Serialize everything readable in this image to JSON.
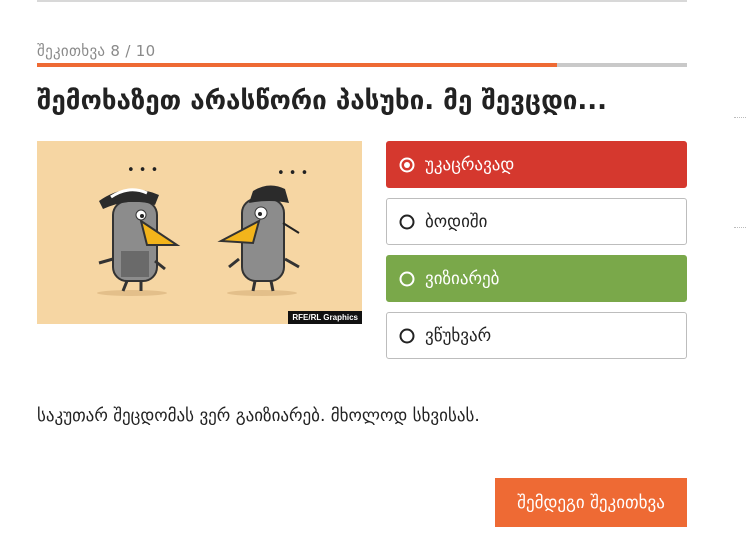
{
  "quiz": {
    "counter": "შეკითხვა 8 / 10",
    "progress_fraction": 0.8,
    "question": "შემოხაზეთ არასწორი პასუხი. მე შევცდი...",
    "image": {
      "credit": "RFE/RL Graphics",
      "thought_dots_left": "• • •",
      "thought_dots_right": "• • •"
    },
    "options": [
      {
        "label": "უკაცრავად",
        "state": "selected-wrong"
      },
      {
        "label": "ბოდიში",
        "state": "none"
      },
      {
        "label": "ვიზიარებ",
        "state": "correct"
      },
      {
        "label": "ვწუხვარ",
        "state": "none"
      }
    ],
    "explanation": "საკუთარ შეცდომას ვერ გაიზიარებ. მხოლოდ სხვისას.",
    "next_label": "შემდეგი შეკითხვა"
  },
  "colors": {
    "accent": "#ee6a34",
    "wrong": "#d5382e",
    "correct": "#7aa84a",
    "illustration_bg": "#f6d6a3"
  }
}
